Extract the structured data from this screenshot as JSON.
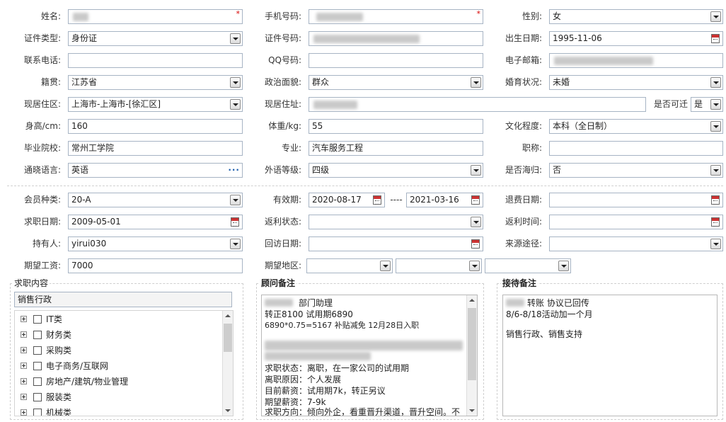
{
  "section1": {
    "name": {
      "label": "姓名:"
    },
    "mobile": {
      "label": "手机号码:"
    },
    "gender": {
      "label": "性别:",
      "value": "女"
    },
    "id_type": {
      "label": "证件类型:",
      "value": "身份证"
    },
    "id_number": {
      "label": "证件号码:"
    },
    "birth_date": {
      "label": "出生日期:",
      "value": "1995-11-06"
    },
    "phone": {
      "label": "联系电话:"
    },
    "qq": {
      "label": "QQ号码:"
    },
    "email": {
      "label": "电子邮箱:"
    },
    "hometown": {
      "label": "籍贯:",
      "value": "江苏省"
    },
    "political": {
      "label": "政治面貌:",
      "value": "群众"
    },
    "marital": {
      "label": "婚育状况:",
      "value": "未婚"
    },
    "current_area": {
      "label": "现居住区:",
      "value": "上海市-上海市-[徐汇区]"
    },
    "current_address": {
      "label": "现居住址:"
    },
    "relocate": {
      "label": "是否可迁",
      "value": "是"
    },
    "height": {
      "label": "身高/cm:",
      "value": "160"
    },
    "weight": {
      "label": "体重/kg:",
      "value": "55"
    },
    "education": {
      "label": "文化程度:",
      "value": "本科（全日制）"
    },
    "school": {
      "label": "毕业院校:",
      "value": "常州工学院"
    },
    "major": {
      "label": "专业:",
      "value": "汽车服务工程"
    },
    "title": {
      "label": "职称:",
      "value": ""
    },
    "language": {
      "label": "通晓语言:",
      "value": "英语"
    },
    "lang_level": {
      "label": "外语等级:",
      "value": "四级"
    },
    "returnee": {
      "label": "是否海归:",
      "value": "否"
    }
  },
  "section2": {
    "member_type": {
      "label": "会员种类:",
      "value": "20-A"
    },
    "valid_period": {
      "label": "有效期:",
      "from": "2020-08-17",
      "sep": "----",
      "to": "2021-03-16"
    },
    "refund_date": {
      "label": "退费日期:",
      "value": ""
    },
    "job_date": {
      "label": "求职日期:",
      "value": "2009-05-01"
    },
    "rebate_status": {
      "label": "返利状态:",
      "value": ""
    },
    "rebate_time": {
      "label": "返利时间:",
      "value": ""
    },
    "holder": {
      "label": "持有人:",
      "value": "yirui030"
    },
    "visit_date": {
      "label": "回访日期:",
      "value": ""
    },
    "source": {
      "label": "来源途径:",
      "value": ""
    },
    "salary": {
      "label": "期望工资:",
      "value": "7000"
    },
    "region": {
      "label": "期望地区:"
    }
  },
  "job_panel": {
    "title": "求职内容",
    "summary": "销售行政",
    "tree": [
      "IT类",
      "财务类",
      "采购类",
      "电子商务/互联网",
      "房地产/建筑/物业管理",
      "服装类",
      "机械类"
    ]
  },
  "advisor_panel": {
    "title": "顾问备注",
    "lines": [
      "部门助理",
      "转正8100 试用期6890",
      "6890*0.75=5167  补贴减免  12月28日入职",
      "",
      "",
      "求职状态：离职，在一家公司的试用期",
      "离职原因：个人发展",
      "目前薪资：试用期7k，转正另议",
      "期望薪资：7-9k",
      "求职方向：倾向外企，看重晋升渠道，晋升空间。不"
    ]
  },
  "reception_panel": {
    "title": "接待备注",
    "lines": [
      "转账  协议已回传",
      "8/6-8/18活动加一个月",
      "",
      "销售行政、销售支持"
    ]
  }
}
